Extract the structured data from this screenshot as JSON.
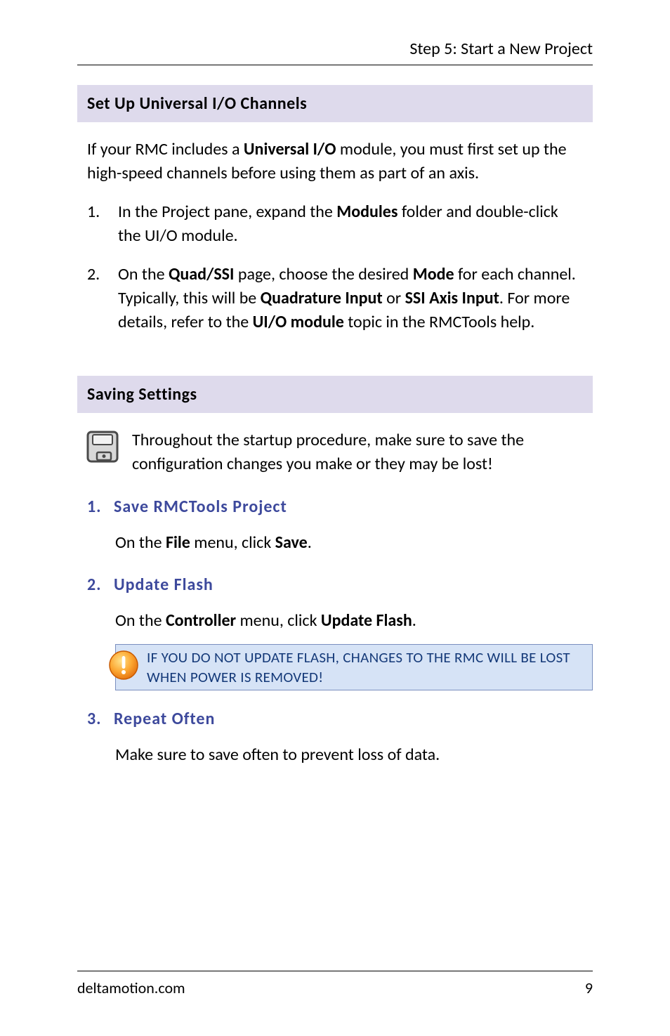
{
  "header": {
    "title": "Step 5: Start a New Project"
  },
  "section1": {
    "title": "Set Up Universal I/O Channels",
    "intro_pre": "If your RMC includes a ",
    "intro_bold": "Universal I/O",
    "intro_post": " module, you must first set up the high-speed channels before using them as part of an axis.",
    "item1": {
      "num": "1.",
      "pre": "In the Project pane, expand the ",
      "bold1": "Modules",
      "post": " folder and double-click the UI/O module."
    },
    "item2": {
      "num": "2.",
      "p1_pre": "On the ",
      "p1_b1": "Quad/SSI",
      "p1_mid1": " page, choose the desired ",
      "p1_b2": "Mode",
      "p1_mid2": " for each channel. Typically, this will be ",
      "p1_b3": "Quadrature Input",
      "p1_mid3": " or ",
      "p1_b4": "SSI Axis Input",
      "p1_mid4": ". For more details, refer to the ",
      "p1_b5": "UI/O module",
      "p1_post": " topic in the RMCTools help."
    }
  },
  "section2": {
    "title": "Saving Settings",
    "intro": "Throughout the startup procedure, make sure to save the configuration changes you make or they may be lost!",
    "sub1": {
      "num": "1.",
      "title": "Save RMCTools Project",
      "body_pre": "On the ",
      "body_b1": "File",
      "body_mid": " menu, click ",
      "body_b2": "Save",
      "body_post": "."
    },
    "sub2": {
      "num": "2.",
      "title": "Update Flash",
      "body_pre": "On the ",
      "body_b1": "Controller",
      "body_mid": " menu, click ",
      "body_b2": "Update Flash",
      "body_post": ".",
      "callout": "IF YOU DO NOT UPDATE FLASH, CHANGES TO THE RMC WILL BE LOST WHEN POWER IS REMOVED!"
    },
    "sub3": {
      "num": "3.",
      "title": "Repeat Often",
      "body": "Make sure to save often to prevent loss of data."
    }
  },
  "footer": {
    "left": "deltamotion.com",
    "right": "9"
  }
}
